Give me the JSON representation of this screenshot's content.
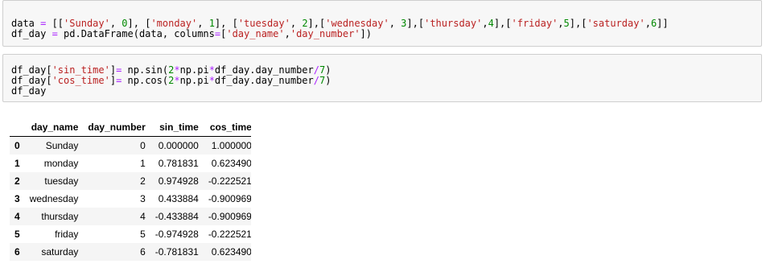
{
  "cells": [
    {
      "lines": [
        "data = [['Sunday', 0], ['monday', 1], ['tuesday', 2],['wednesday', 3],['thursday',4],['friday',5],['saturday',6]]",
        "df_day = pd.DataFrame(data, columns=['day_name','day_number'])"
      ]
    },
    {
      "lines": [
        "df_day['sin_time']= np.sin(2*np.pi*df_day.day_number/7)",
        "df_day['cos_time']= np.cos(2*np.pi*df_day.day_number/7)",
        "df_day"
      ]
    }
  ],
  "output_table": {
    "columns": [
      "",
      "day_name",
      "day_number",
      "sin_time",
      "cos_time"
    ],
    "rows": [
      [
        "0",
        "Sunday",
        "0",
        "0.000000",
        "1.000000"
      ],
      [
        "1",
        "monday",
        "1",
        "0.781831",
        "0.623490"
      ],
      [
        "2",
        "tuesday",
        "2",
        "0.974928",
        "-0.222521"
      ],
      [
        "3",
        "wednesday",
        "3",
        "0.433884",
        "-0.900969"
      ],
      [
        "4",
        "thursday",
        "4",
        "-0.433884",
        "-0.900969"
      ],
      [
        "5",
        "friday",
        "5",
        "-0.974928",
        "-0.222521"
      ],
      [
        "6",
        "saturday",
        "6",
        "-0.781831",
        "0.623490"
      ]
    ]
  },
  "colors": {
    "string": "#ba2121",
    "number": "#008800",
    "operator": "#aa22ff",
    "cell_background": "#f7f7f7"
  }
}
